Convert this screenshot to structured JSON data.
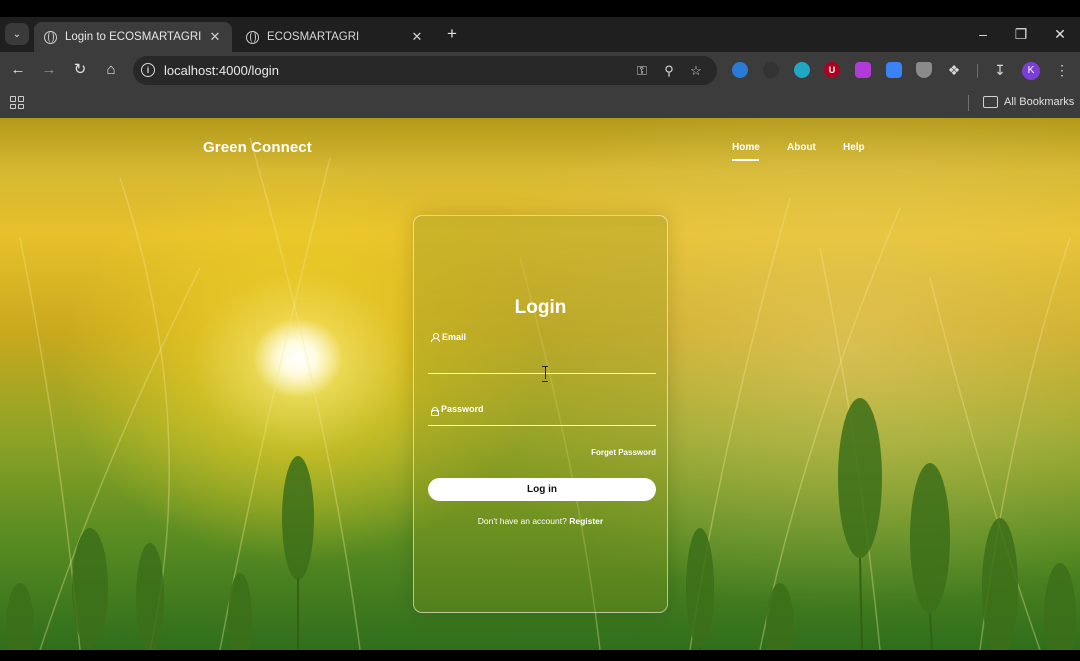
{
  "browser": {
    "tabs": [
      {
        "title": "Login to ECOSMARTAGRI",
        "active": true
      },
      {
        "title": "ECOSMARTAGRI",
        "active": false
      }
    ],
    "url": "localhost:4000/login",
    "bookmarks_label": "All Bookmarks",
    "profile_initial": "K",
    "extensions": [
      {
        "name": "blue-circle-extension",
        "color": "#2a7bd6",
        "glyph": ""
      },
      {
        "name": "dark-moon-extension",
        "color": "#3a3a3a",
        "glyph": ""
      },
      {
        "name": "cyan-refresh-extension",
        "color": "#1fa7c4",
        "glyph": ""
      },
      {
        "name": "ublock-extension",
        "color": "#b00020",
        "glyph": "U"
      },
      {
        "name": "purple-extension",
        "color": "#b23ad6",
        "glyph": ""
      },
      {
        "name": "image-extension",
        "color": "#3b82f6",
        "glyph": ""
      },
      {
        "name": "shield-extension",
        "color": "#8a8a8a",
        "glyph": ""
      }
    ]
  },
  "site": {
    "brand": "Green Connect",
    "nav": [
      {
        "label": "Home",
        "active": true
      },
      {
        "label": "About",
        "active": false
      },
      {
        "label": "Help",
        "active": false
      }
    ]
  },
  "login": {
    "title": "Login",
    "email_label": "Email",
    "email_value": "",
    "password_label": "Password",
    "password_value": "",
    "forgot_label": "Forget Password",
    "submit_label": "Log in",
    "register_prompt": "Don't have an account?",
    "register_link": "Register"
  },
  "colors": {
    "chrome_dark": "#1f1f1f",
    "chrome_toolbar": "#3c3c3c",
    "background_sky": "#e7c12b",
    "background_field": "#3f7a1e"
  }
}
